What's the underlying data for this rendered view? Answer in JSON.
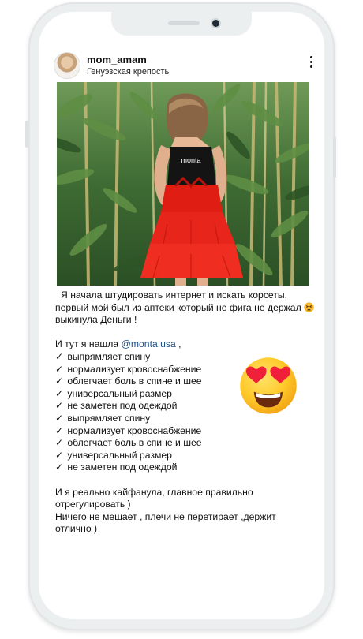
{
  "post": {
    "username": "mom_amam",
    "location": "Генуэзская крепость",
    "photo_print": "monta",
    "emoji_icon": "heart-eyes-emoji"
  },
  "caption": {
    "line1": "Я начала штудировать интернет и искать корсеты,",
    "line2": "первый мой был из аптеки который не фига не держал",
    "line3": "выкинула Деньги !",
    "found_prefix": "И тут я нашла ",
    "mention": "@monta.usa",
    "found_suffix": " ,",
    "checks": [
      "выпрямляет спину",
      "нормализует кровоснабжение",
      "облегчает боль в спине и шее",
      "универсальный размер",
      "не заметен под одеждой",
      "выпрямляет спину",
      "нормализует кровоснабжение",
      "облегчает боль в спине и шее",
      "универсальный размер",
      "не заметен под одеждой"
    ],
    "check_mark": "✓",
    "ending1": "И я реально кайфанула, главное правильно",
    "ending2": "отрегулировать )",
    "ending3": "Ничего не мешает , плечи не перетирает ,держит",
    "ending4": "отлично )"
  }
}
